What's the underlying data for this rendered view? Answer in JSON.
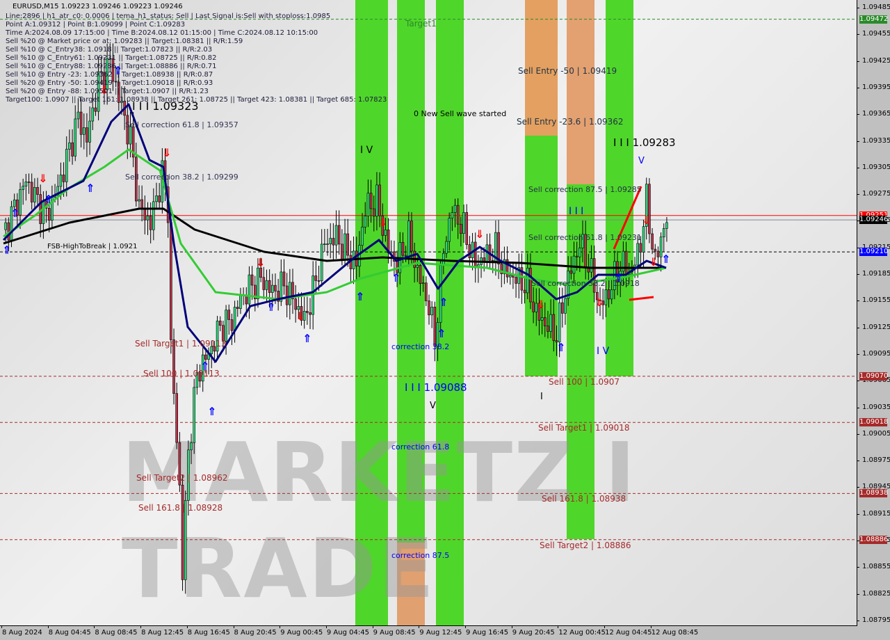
{
  "header": {
    "symbol_line": "EURUSD,M15  1.09223 1.09246 1.09223 1.09246",
    "info_lines": [
      "Line:2896 | h1_atr_c0: 0.0006 | tema_h1_status: Sell | Last Signal is:Sell with stoploss:1.0985",
      "Point A:1.09312 | Point B:1.09099 | Point C:1.09283",
      "Time A:2024.08.09 17:15:00 | Time B:2024.08.12 01:15:00 | Time C:2024.08.12 10:15:00",
      "Sell %20 @ Market price or at: 1.09283 || Target:1.08381 || R/R:1.59",
      "Sell %10 @ C_Entry38: 1.0918 || Target:1.07823 || R/R:2.03",
      "Sell %10 @ C_Entry61: 1.09231 || Target:1.08725 || R/R:0.82",
      "Sell %10 @ C_Entry88: 1.09286 || Target:1.08886 || R/R:0.71",
      "Sell %10 @ Entry -23: 1.09362 || Target:1.08938 || R/R:0.87",
      "Sell %20 @ Entry -50: 1.09419 || Target:1.09018 || R/R:0.93",
      "Sell %20 @ Entry -88: 1.09501 || Target:1.0907 || R/R:1.23",
      "Target100: 1.0907 || Target 161: 1.08938 || Target 261: 1.08725 || Target 423: 1.08381 || Target 685: 1.07823"
    ]
  },
  "watermark": "MARKETZ I TRADE",
  "colors": {
    "bull": "#2fd67a",
    "bear": "#b8334a",
    "band_green": "#4fd62a",
    "band_orange": "#e8a070",
    "level_red": "#a52a2a",
    "ma_slow": "#000000",
    "ma_mid": "#33cc33",
    "ma_fast": "#00007a"
  },
  "annotations": {
    "target1": "Target1",
    "new_wave": "0 New Sell wave started",
    "wave_a_left": "I I I 1.09323",
    "sell_corr_618_left": "Sell correction 61.8 | 1.09357",
    "sell_corr_382_left": "Sell correction 38.2 | 1.09299",
    "fsb": "FSB-HighToBreak | 1.0921",
    "sell_target1_left": "Sell Target1 | 1.09113",
    "sell_100_left": "Sell 100 | 1.09113",
    "sell_target2_left": "Sell Target2 | 1.08962",
    "sell_1618_left": "Sell 161.8 | 1.08928",
    "wave_iv_mid": "I V",
    "corr_382": "correction 38.2",
    "wave_mid": "I I I 1.09088",
    "wave_v_mid": "V",
    "corr_618": "correction 61.8",
    "corr_875": "correction 87.5",
    "sell_entry_50": "Sell Entry -50 | 1.09419",
    "sell_entry_236": "Sell Entry -23.6 | 1.09362",
    "wave_right": "I I I 1.09283",
    "sell_corr_875": "Sell correction 87.5 | 1.09285",
    "wave_iii_small": "I I I",
    "sell_corr_618": "Sell correction 61.8 | 1.09231",
    "sell_corr_382": "Sell correction 38.2 | 1.0918",
    "wave_v_right": "V",
    "wave_iv_right": "I V",
    "wave_i_right": "I",
    "sell_100": "Sell 100 | 1.0907",
    "sell_target1": "Sell Target1 | 1.09018",
    "sell_1618": "Sell 161.8 | 1.08938",
    "sell_target2": "Sell Target2 | 1.08886"
  },
  "price_tags": [
    {
      "value": "1.09472",
      "color": "#2a8a2a"
    },
    {
      "value": "1.09251",
      "color": "#ff0000"
    },
    {
      "value": "1.09246",
      "color": "#000000"
    },
    {
      "value": "1.09210",
      "color": "#0000ff"
    },
    {
      "value": "1.09070",
      "color": "#a52a2a"
    },
    {
      "value": "1.09018",
      "color": "#a52a2a"
    },
    {
      "value": "1.08938",
      "color": "#a52a2a"
    },
    {
      "value": "1.08886",
      "color": "#a52a2a"
    }
  ],
  "chart_data": {
    "type": "candlestick",
    "symbol": "EURUSD",
    "timeframe": "M15",
    "ylim": [
      1.08795,
      1.09485
    ],
    "y_ticks": [
      "1.09485",
      "1.09455",
      "1.09425",
      "1.09395",
      "1.09365",
      "1.09335",
      "1.09305",
      "1.09275",
      "1.09245",
      "1.09215",
      "1.09185",
      "1.09155",
      "1.09125",
      "1.09095",
      "1.09065",
      "1.09035",
      "1.09005",
      "1.08975",
      "1.08945",
      "1.08915",
      "1.08885",
      "1.08855",
      "1.08825",
      "1.08795"
    ],
    "x_ticks": [
      "8 Aug 2024",
      "8 Aug 04:45",
      "8 Aug 08:45",
      "8 Aug 12:45",
      "8 Aug 16:45",
      "8 Aug 20:45",
      "9 Aug 00:45",
      "9 Aug 04:45",
      "9 Aug 08:45",
      "9 Aug 12:45",
      "9 Aug 16:45",
      "9 Aug 20:45",
      "12 Aug 00:45",
      "12 Aug 04:45",
      "12 Aug 08:45"
    ],
    "close_path": [
      [
        1,
        1.09235
      ],
      [
        4,
        1.09259
      ],
      [
        8,
        1.0929
      ],
      [
        12,
        1.09267
      ],
      [
        15,
        1.09251
      ],
      [
        19,
        1.09282
      ],
      [
        22,
        1.09314
      ],
      [
        26,
        1.09361
      ],
      [
        29,
        1.09337
      ],
      [
        33,
        1.094
      ],
      [
        37,
        1.09423
      ],
      [
        40,
        1.09384
      ],
      [
        44,
        1.09337
      ],
      [
        47,
        1.09259
      ],
      [
        51,
        1.09243
      ],
      [
        55,
        1.09298
      ],
      [
        57,
        1.09259
      ],
      [
        58,
        1.09102
      ],
      [
        61,
        1.08945
      ],
      [
        62,
        1.08851
      ],
      [
        64,
        1.08985
      ],
      [
        67,
        1.09071
      ],
      [
        69,
        1.09086
      ],
      [
        71,
        1.09094
      ],
      [
        75,
        1.09126
      ],
      [
        79,
        1.09133
      ],
      [
        82,
        1.09157
      ],
      [
        86,
        1.09172
      ],
      [
        89,
        1.0918
      ],
      [
        93,
        1.09165
      ],
      [
        97,
        1.09172
      ],
      [
        100,
        1.09157
      ],
      [
        104,
        1.09133
      ],
      [
        107,
        1.09165
      ],
      [
        111,
        1.0922
      ],
      [
        115,
        1.09227
      ],
      [
        118,
        1.09212
      ],
      [
        122,
        1.09196
      ],
      [
        125,
        1.09259
      ],
      [
        129,
        1.09267
      ],
      [
        133,
        1.09212
      ],
      [
        136,
        1.09196
      ],
      [
        140,
        1.09227
      ],
      [
        143,
        1.09188
      ],
      [
        147,
        1.09149
      ],
      [
        149,
        1.0911
      ],
      [
        152,
        1.09212
      ],
      [
        155,
        1.09259
      ],
      [
        159,
        1.09235
      ],
      [
        163,
        1.09196
      ],
      [
        166,
        1.09204
      ],
      [
        170,
        1.09212
      ],
      [
        173,
        1.09188
      ],
      [
        177,
        1.0918
      ],
      [
        181,
        1.09172
      ],
      [
        184,
        1.09141
      ],
      [
        188,
        1.09126
      ],
      [
        191,
        1.09118
      ],
      [
        195,
        1.0918
      ],
      [
        199,
        1.0922
      ],
      [
        202,
        1.09196
      ],
      [
        206,
        1.09149
      ],
      [
        209,
        1.09165
      ],
      [
        213,
        1.09196
      ],
      [
        217,
        1.09188
      ],
      [
        220,
        1.0922
      ],
      [
        222,
        1.09267
      ],
      [
        225,
        1.09196
      ],
      [
        227,
        1.09227
      ],
      [
        229,
        1.09246
      ]
    ],
    "levels": [
      {
        "price": 1.09472,
        "style": "dashed",
        "color": "#2a8a2a"
      },
      {
        "price": 1.09251,
        "style": "solid",
        "color": "#ff0000"
      },
      {
        "price": 1.09246,
        "style": "solid",
        "color": "#808890"
      },
      {
        "price": 1.0921,
        "style": "dashed",
        "color": "#000000"
      },
      {
        "price": 1.0907,
        "style": "dashed",
        "color": "#a52a2a"
      },
      {
        "price": 1.09018,
        "style": "dashed",
        "color": "#a52a2a"
      },
      {
        "price": 1.08938,
        "style": "dashed",
        "color": "#a52a2a"
      },
      {
        "price": 1.08886,
        "style": "dashed",
        "color": "#a52a2a"
      }
    ],
    "grid": false
  }
}
